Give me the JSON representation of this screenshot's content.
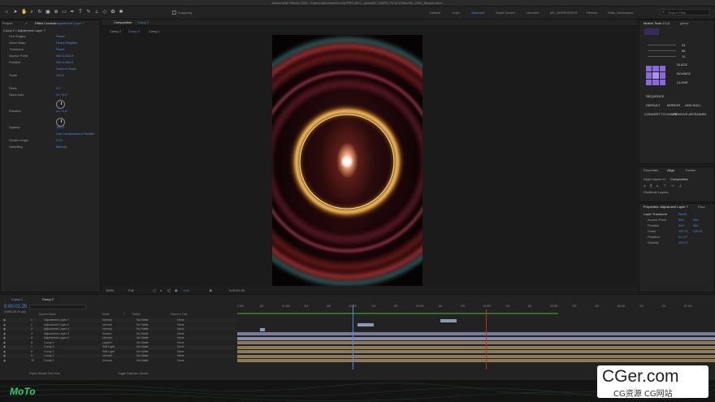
{
  "window": {
    "title": "Adobe After Effects 2020 - /Users/mthomas/Dev/zip/PRO-6671_spiral/EP_WAFN_SOUL/Gilbert09_2022_Shapes.aep *"
  },
  "toolbar": {
    "snapping_label": "Snapping",
    "workspaces": [
      "Default",
      "Learn",
      "Standard",
      "Small Screen",
      "Libraries",
      "MY_WORKSPACE",
      "Review",
      "Wide_Workspace"
    ],
    "active_workspace": "Standard",
    "search_placeholder": "Search Help"
  },
  "project_panel": {
    "tab_project": "Project",
    "tab_effect_controls": "Effect Controls",
    "effect_controls_target": "Adjustment Layer 7",
    "comp_path": "Comp 2 • Adjustment Layer 7",
    "rows": [
      {
        "label": "Find Edges",
        "value": "Reset"
      },
      {
        "label": "Wave Warp",
        "value": "Reset    Register"
      },
      {
        "label": "Transform",
        "value": "Reset"
      },
      {
        "label": "Anchor Point",
        "value": "540.0,960.0"
      },
      {
        "label": "Position",
        "value": "540.0,960.0"
      },
      {
        "label": "",
        "value": "Uniform Scale"
      },
      {
        "label": "Scale",
        "value": "100.0"
      },
      {
        "label": "",
        "value": ""
      },
      {
        "label": "Skew",
        "value": "0.0"
      },
      {
        "label": "Skew Axis",
        "value": "0x +0.0°"
      },
      {
        "label": "Rotation",
        "value": "0x +0.0°"
      },
      {
        "label": "Opacity",
        "value": "100.0"
      },
      {
        "label": "",
        "value": "Use Composition's Shutter"
      },
      {
        "label": "Shutter Angle",
        "value": "0.00"
      },
      {
        "label": "Sampling",
        "value": "Bilinear"
      }
    ]
  },
  "composition": {
    "tab_label": "Composition",
    "comp_name": "Comp 2",
    "breadcrumbs": [
      "Comp 2",
      "Comp 2",
      "Comp 1"
    ],
    "zoom": "100%",
    "resolution": "Full",
    "timecode": "0:00:01:25",
    "exposure": "+0.0"
  },
  "motion_tools": {
    "title": "Motion Tools 2.1.2",
    "tab2": "giflzer",
    "buttons": [
      "SLACE",
      "BOUNCE",
      "CLONE",
      "SEQUENCE",
      "DEFAULT",
      "MIRROR",
      "ADD NULL"
    ],
    "footer": [
      "CONVERT TO SHAPE",
      "REMOVE ARTBOARD"
    ],
    "values": [
      "24",
      "96",
      "12"
    ]
  },
  "align_panel": {
    "tabs": [
      "Essentials",
      "Align",
      "Tracker"
    ],
    "align_layers_to": "Align Layers to:",
    "target": "Composition",
    "distribute": "Distribute Layers:"
  },
  "properties_panel": {
    "title": "Properties: Adjustment Layer 7",
    "tab2": "Para",
    "section": "Layer Transform",
    "reset": "Reset",
    "rows": [
      {
        "label": "Anchor Point",
        "v1": "540",
        "v2": "960"
      },
      {
        "label": "Position",
        "v1": "540",
        "v2": "960"
      },
      {
        "label": "Scale",
        "v1": "100 %",
        "v2": "100 %"
      },
      {
        "label": "Rotation",
        "v1": "0x +0°",
        "v2": ""
      },
      {
        "label": "Opacity",
        "v1": "100 %",
        "v2": ""
      }
    ]
  },
  "timeline": {
    "tabs": [
      "Comp 1",
      "Comp 2"
    ],
    "timecode": "0:00:01:25",
    "frames": "00055 (30.00 fps)",
    "headers": [
      "Source Name",
      "Mode",
      "T",
      "TrkMat",
      "Parent & Link"
    ],
    "layers": [
      {
        "num": "1",
        "name": "Adjustment Layer 7",
        "mode": "Normal",
        "trk": "No Matte",
        "parent": "None"
      },
      {
        "num": "2",
        "name": "Adjustment Layer 5",
        "mode": "Normal",
        "trk": "No Matte",
        "parent": "None"
      },
      {
        "num": "3",
        "name": "Adjustment Layer 4",
        "mode": "Normal",
        "trk": "No Matte",
        "parent": "None"
      },
      {
        "num": "4",
        "name": "Adjustment Layer 3",
        "mode": "Screen",
        "trk": "No Matte",
        "parent": "None"
      },
      {
        "num": "5",
        "name": "Adjustment Layer 2",
        "mode": "Normal",
        "trk": "No Matte",
        "parent": "None"
      },
      {
        "num": "6",
        "name": "Comp 1",
        "mode": "Lighten",
        "trk": "No Matte",
        "parent": "None"
      },
      {
        "num": "7",
        "name": "Comp 1",
        "mode": "Soft Light",
        "trk": "No Matte",
        "parent": "None"
      },
      {
        "num": "8",
        "name": "Comp 1",
        "mode": "Soft Light",
        "trk": "No Matte",
        "parent": "None"
      },
      {
        "num": "9",
        "name": "Comp 1",
        "mode": "Normal",
        "trk": "No Matte",
        "parent": "None"
      },
      {
        "num": "10",
        "name": "Comp 1",
        "mode": "Normal",
        "trk": "No Matte",
        "parent": "None"
      }
    ],
    "ruler": [
      "0:00f",
      "10f",
      "01:00f",
      "10f",
      "20f",
      "02:00f",
      "10f",
      "20f",
      "03:00f",
      "10f",
      "20f",
      "04:00f",
      "10f",
      "20f",
      "05:00f",
      "10f",
      "20f",
      "06:00f",
      "10f",
      "20f",
      "07:00f"
    ],
    "footer_left": "Frame Render Time  0ms",
    "footer_mid": "Toggle Switches / Modes"
  },
  "watermark": {
    "text": "CGer.com",
    "sub": "CG资源 CG网站"
  },
  "colors": {
    "accent": "#4a8de0",
    "ring": "#f0b040",
    "bg": "#1d1d1d"
  }
}
